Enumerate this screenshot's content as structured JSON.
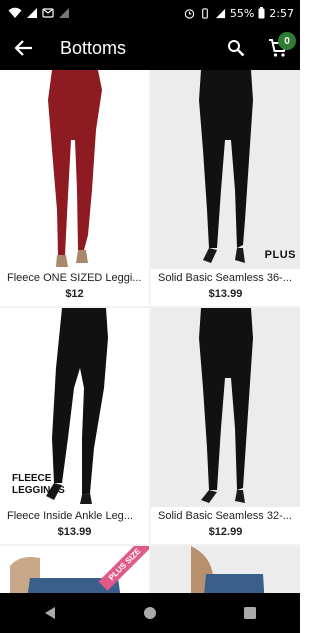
{
  "status_bar": {
    "battery": "55%",
    "time": "2:57"
  },
  "app_bar": {
    "title": "Bottoms",
    "cart_count": "0"
  },
  "products": [
    {
      "name": "Fleece ONE SIZED Leggi...",
      "price": "$12",
      "color": "#8e1a22"
    },
    {
      "name": "Solid Basic Seamless 36-...",
      "price": "$13.99",
      "tag": "PLUS",
      "color": "#111111"
    },
    {
      "name": "Fleece Inside Ankle Leg...",
      "price": "$13.99",
      "tag_line1": "FLEECE",
      "tag_line2": "LEGGINGS",
      "color": "#111111"
    },
    {
      "name": "Solid Basic Seamless 32-...",
      "price": "$12.99",
      "color": "#111111"
    },
    {
      "ribbon": "PLUS SIZE",
      "color": "#3a5f8a"
    },
    {
      "color": "#3a5f8a"
    }
  ],
  "icons": {
    "back": "arrow-back-icon",
    "search": "search-icon",
    "cart": "cart-icon"
  }
}
